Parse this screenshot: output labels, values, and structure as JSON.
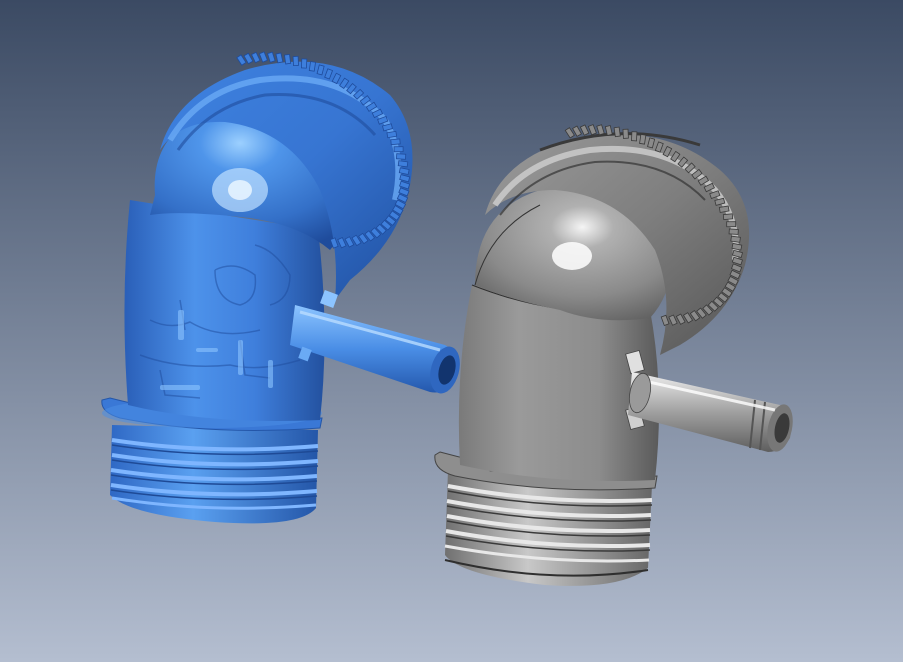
{
  "scene": {
    "background": {
      "top_color": "#3b4a63",
      "bottom_color": "#b4bed0"
    },
    "models": [
      {
        "kind": "scanned-mesh",
        "color": "#3f7fdc",
        "highlight": "#8cc4ff",
        "shadow": "#1f4fa0"
      },
      {
        "kind": "cad-model",
        "color": "#8c8c8c",
        "highlight": "#f2f2f2",
        "shadow": "#4a4a4a"
      }
    ]
  }
}
